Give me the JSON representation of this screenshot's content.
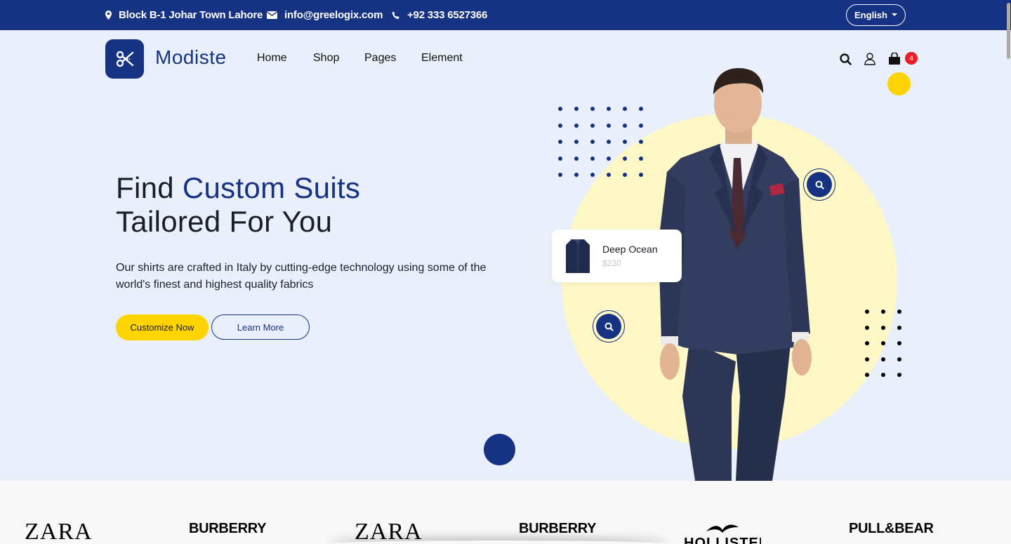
{
  "topbar": {
    "address": "Block B-1 Johar Town Lahore",
    "email": "info@greelogix.com",
    "phone": "+92 333 6527366",
    "language": "English"
  },
  "nav": {
    "brand": "Modiste",
    "links": [
      "Home",
      "Shop",
      "Pages",
      "Element"
    ],
    "cart_count": "4"
  },
  "hero": {
    "title_plain_1": "Find ",
    "title_accent": "Custom Suits",
    "title_line_2": "Tailored For You",
    "description": "Our shirts are crafted in Italy by cutting-edge technology using some of the world's finest and highest quality fabrics",
    "primary_button": "Customize Now",
    "secondary_button": "Learn More"
  },
  "product_card": {
    "name": "Deep Ocean",
    "price": "$230"
  },
  "brands": [
    "ZARA",
    "BURBERRY",
    "ZARA",
    "BURBERRY",
    "HOLLISTER",
    "PULL&BEAR"
  ],
  "colors": {
    "primary": "#163283",
    "accent": "#ffd400",
    "badge": "#ee1c25",
    "hero_bg": "#e9f0fb",
    "circle": "#fef7c6"
  }
}
